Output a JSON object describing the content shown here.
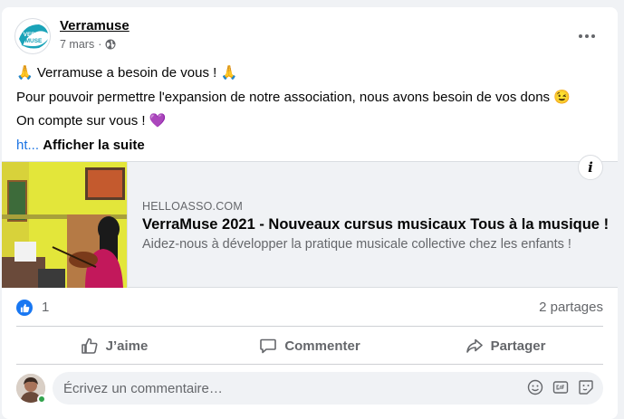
{
  "post": {
    "author": "Verramuse",
    "time": "7 mars",
    "avatar_logo_text": "VERRA MUSE",
    "more_icon": "more-horizontal-icon",
    "lines": [
      {
        "pre": "🙏 Verramuse a besoin de vous ! 🙏"
      },
      {
        "pre": "Pour pouvoir permettre l'expansion de notre association, nous avons besoin de vos dons 😉"
      },
      {
        "pre": "On compte sur vous ! 💜"
      }
    ],
    "link_fragment": "ht...",
    "see_more": "Afficher la suite"
  },
  "preview": {
    "domain": "HELLOASSO.COM",
    "title": "VerraMuse 2021 - Nouveaux cursus musicaux Tous à la musique !",
    "description": "Aidez-nous à développer la pratique musicale collective chez les enfants !",
    "info_label": "i"
  },
  "reactions": {
    "count": "1",
    "shares": "2 partages"
  },
  "actions": {
    "like": "J’aime",
    "comment": "Commenter",
    "share": "Partager"
  },
  "comment_box": {
    "placeholder": "Écrivez un commentaire…"
  },
  "colors": {
    "accent": "#1877f2",
    "link": "#1b74e4",
    "muted": "#65676b",
    "online": "#31a24c"
  }
}
